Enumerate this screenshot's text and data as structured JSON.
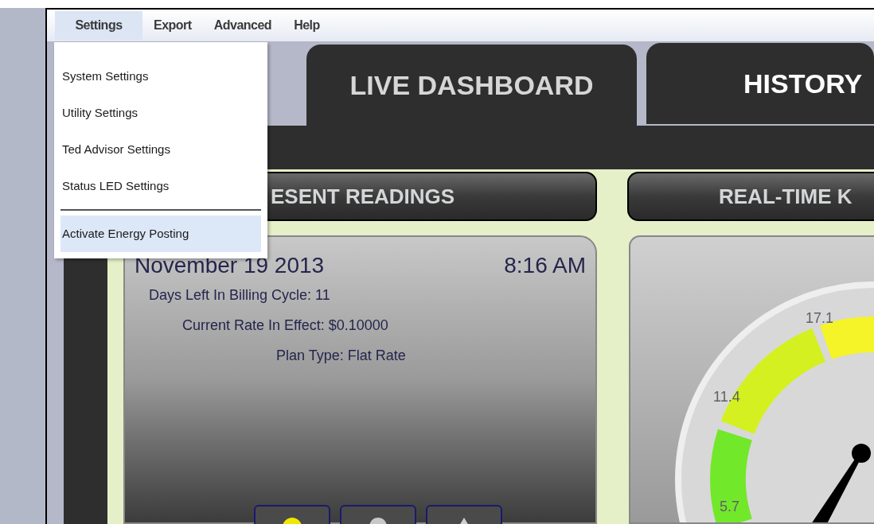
{
  "menubar": [
    {
      "label": "Settings",
      "selected": true
    },
    {
      "label": "Export",
      "selected": false
    },
    {
      "label": "Advanced",
      "selected": false
    },
    {
      "label": "Help",
      "selected": false
    }
  ],
  "menu": [
    {
      "kind": "item",
      "label": "System Settings",
      "selected": false
    },
    {
      "kind": "item",
      "label": "Utility Settings",
      "selected": false
    },
    {
      "kind": "item",
      "label": "Ted Advisor Settings",
      "selected": false
    },
    {
      "kind": "item",
      "label": "Status LED Settings",
      "selected": false
    },
    {
      "kind": "separator"
    },
    {
      "kind": "item",
      "label": "Activate Energy Posting",
      "selected": true
    }
  ],
  "tabs": [
    {
      "label": "LIVE DASHBOARD",
      "selected": true
    },
    {
      "label": "HISTORY",
      "selected": false
    }
  ],
  "readings": {
    "header": "ESENT READINGS",
    "date": "November 19 2013",
    "time": "8:16 AM",
    "lines": [
      "Days Left In Billing Cycle: 11",
      "Current Rate In Effect: $0.10000",
      "Plan Type: Flat Rate"
    ]
  },
  "gauge": {
    "header": "REAL-TIME K",
    "tick_labels": [
      "17.1",
      "11.4",
      "5.7"
    ]
  }
}
